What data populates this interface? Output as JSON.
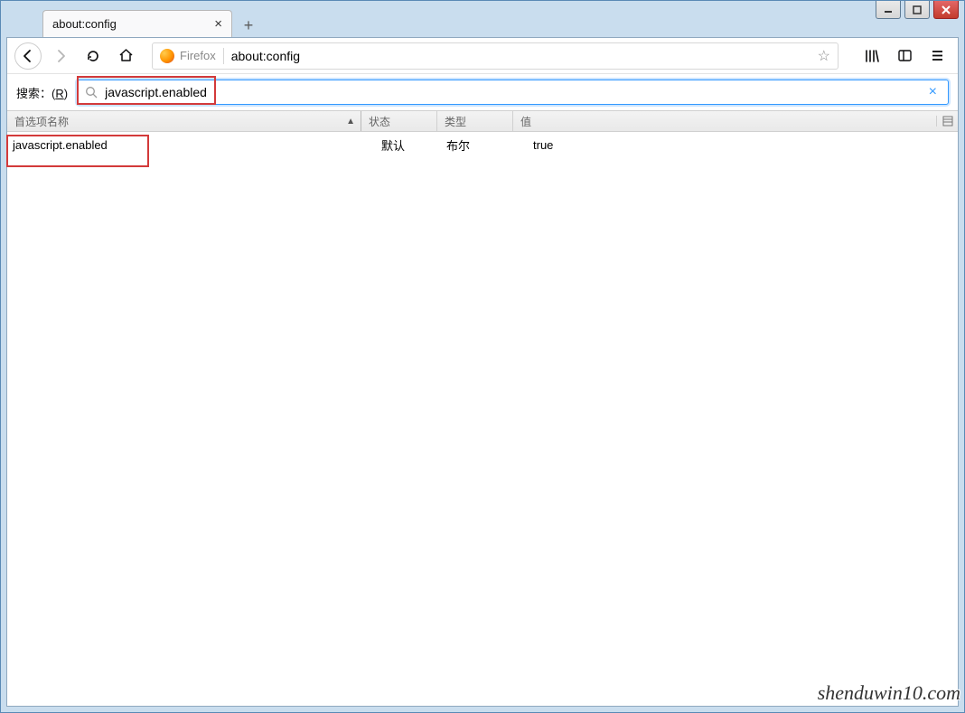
{
  "tab": {
    "title": "about:config",
    "close_glyph": "×"
  },
  "new_tab_glyph": "+",
  "urlbar": {
    "brand_label": "Firefox",
    "url": "about:config",
    "star_glyph": "☆"
  },
  "search": {
    "label_prefix": "搜索：(",
    "label_key": "R",
    "label_suffix": ")",
    "value": "javascript.enabled",
    "clear_glyph": "×"
  },
  "columns": {
    "pref": "首选项名称",
    "status": "状态",
    "type": "类型",
    "value": "值",
    "sort_glyph": "▲"
  },
  "rows": [
    {
      "name": "javascript.enabled",
      "status": "默认",
      "type": "布尔",
      "value": "true"
    }
  ],
  "watermark": "shenduwin10.com"
}
